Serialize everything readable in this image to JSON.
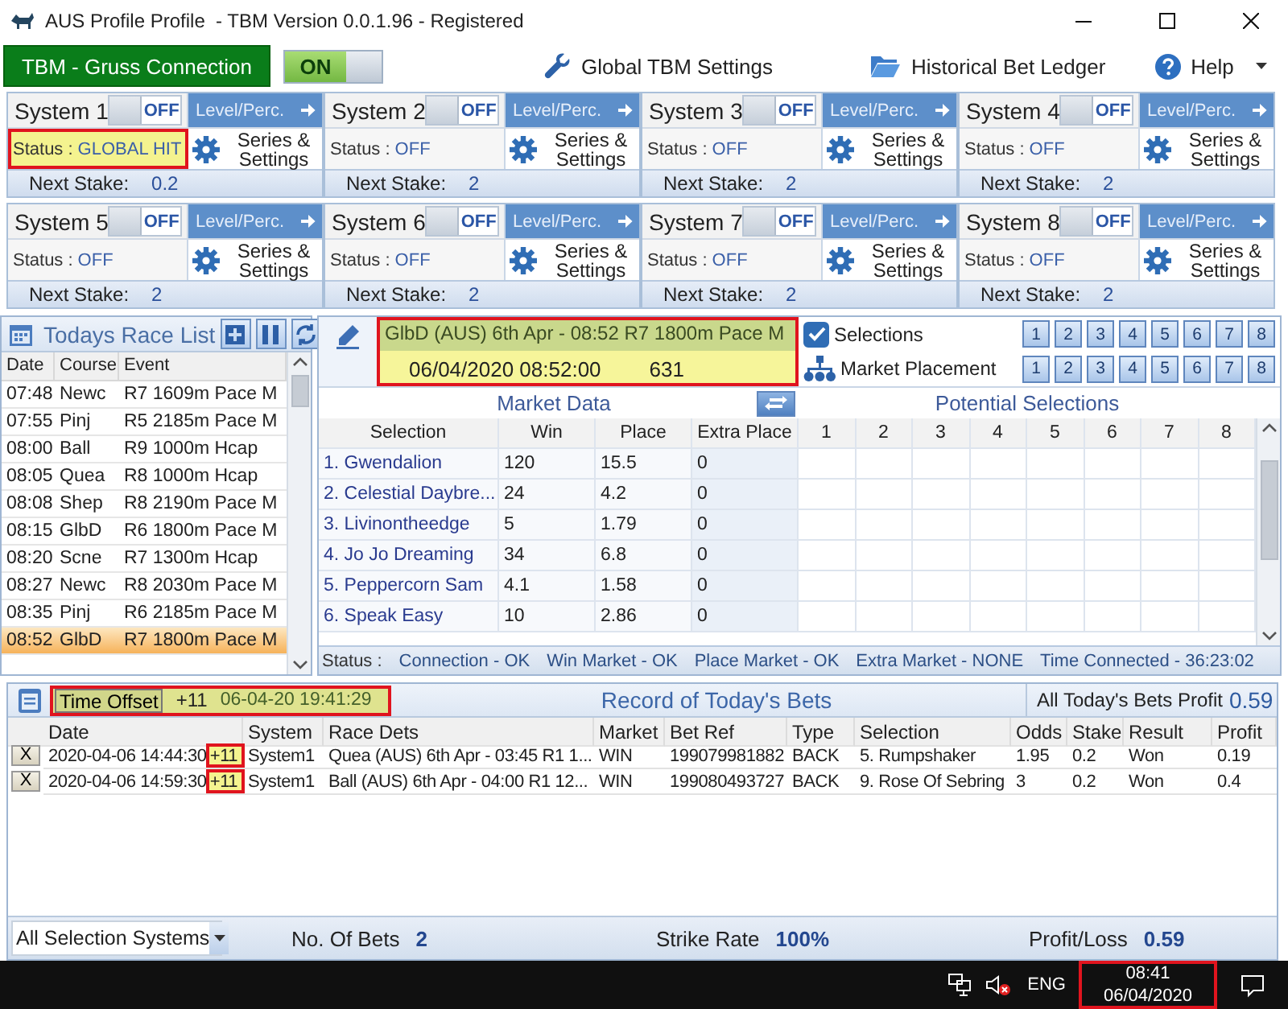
{
  "window": {
    "title": "AUS Profile Profile  - TBM Version 0.0.1.96 - Registered"
  },
  "toolbar": {
    "connection_button": "TBM - Gruss Connection",
    "connection_toggle": {
      "label": "ON",
      "on": true
    },
    "items": [
      {
        "label": "Global TBM Settings",
        "kind": "wrench"
      },
      {
        "label": "Historical Bet Ledger",
        "kind": "folder"
      },
      {
        "label": "Help",
        "kind": "help"
      }
    ]
  },
  "systems": [
    {
      "name": "System 1",
      "toggle": "OFF",
      "on": false,
      "level_button": "Level/Perc.",
      "status_label": "Status :",
      "status": "GLOBAL HIT",
      "highlighted": true,
      "settings_button": "Series & Settings",
      "stake_label": "Next Stake:",
      "stake": "0.2"
    },
    {
      "name": "System 2",
      "toggle": "OFF",
      "on": false,
      "level_button": "Level/Perc.",
      "status_label": "Status :",
      "status": "OFF",
      "highlighted": false,
      "settings_button": "Series & Settings",
      "stake_label": "Next Stake:",
      "stake": "2"
    },
    {
      "name": "System 3",
      "toggle": "OFF",
      "on": false,
      "level_button": "Level/Perc.",
      "status_label": "Status :",
      "status": "OFF",
      "highlighted": false,
      "settings_button": "Series & Settings",
      "stake_label": "Next Stake:",
      "stake": "2"
    },
    {
      "name": "System 4",
      "toggle": "OFF",
      "on": false,
      "level_button": "Level/Perc.",
      "status_label": "Status :",
      "status": "OFF",
      "highlighted": false,
      "settings_button": "Series & Settings",
      "stake_label": "Next Stake:",
      "stake": "2"
    },
    {
      "name": "System 5",
      "toggle": "OFF",
      "on": false,
      "level_button": "Level/Perc.",
      "status_label": "Status :",
      "status": "OFF",
      "highlighted": false,
      "settings_button": "Series & Settings",
      "stake_label": "Next Stake:",
      "stake": "2"
    },
    {
      "name": "System 6",
      "toggle": "OFF",
      "on": false,
      "level_button": "Level/Perc.",
      "status_label": "Status :",
      "status": "OFF",
      "highlighted": false,
      "settings_button": "Series & Settings",
      "stake_label": "Next Stake:",
      "stake": "2"
    },
    {
      "name": "System 7",
      "toggle": "OFF",
      "on": false,
      "level_button": "Level/Perc.",
      "status_label": "Status :",
      "status": "OFF",
      "highlighted": false,
      "settings_button": "Series & Settings",
      "stake_label": "Next Stake:",
      "stake": "2"
    },
    {
      "name": "System 8",
      "toggle": "OFF",
      "on": false,
      "level_button": "Level/Perc.",
      "status_label": "Status :",
      "status": "OFF",
      "highlighted": false,
      "settings_button": "Series & Settings",
      "stake_label": "Next Stake:",
      "stake": "2"
    }
  ],
  "race_list": {
    "title": "Todays Race List",
    "columns": [
      "Date",
      "Course",
      "Event"
    ],
    "rows": [
      {
        "time": "07:48",
        "course": "Newc",
        "event": "R7 1609m Pace M",
        "selected": false
      },
      {
        "time": "07:55",
        "course": "Pinj",
        "event": "R5 2185m Pace M",
        "selected": false
      },
      {
        "time": "08:00",
        "course": "Ball",
        "event": "R9 1000m Hcap",
        "selected": false
      },
      {
        "time": "08:05",
        "course": "Quea",
        "event": "R8 1000m Hcap",
        "selected": false
      },
      {
        "time": "08:08",
        "course": "Shep",
        "event": "R8 2190m Pace M",
        "selected": false
      },
      {
        "time": "08:15",
        "course": "GlbD",
        "event": "R6 1800m Pace M",
        "selected": false
      },
      {
        "time": "08:20",
        "course": "Scne",
        "event": "R7 1300m Hcap",
        "selected": false
      },
      {
        "time": "08:27",
        "course": "Newc",
        "event": "R8 2030m Pace M",
        "selected": false
      },
      {
        "time": "08:35",
        "course": "Pinj",
        "event": "R6 2185m Pace M",
        "selected": false
      },
      {
        "time": "08:52",
        "course": "GlbD",
        "event": "R7 1800m Pace M",
        "selected": true
      }
    ]
  },
  "race_header": {
    "title": "GlbD (AUS) 6th Apr - 08:52 R7 1800m Pace M",
    "start": "06/04/2020 08:52:00",
    "market_id": "631",
    "highlighted": true
  },
  "placement": [
    {
      "kind": "checkbox",
      "label": "Selections",
      "checked": true,
      "buttons": [
        "1",
        "2",
        "3",
        "4",
        "5",
        "6",
        "7",
        "8"
      ]
    },
    {
      "kind": "tree",
      "label": "Market Placement",
      "buttons": [
        "1",
        "2",
        "3",
        "4",
        "5",
        "6",
        "7",
        "8"
      ]
    }
  ],
  "market": {
    "title": "Market Data",
    "potential_title": "Potential Selections",
    "columns": [
      "Selection",
      "Win",
      "Place",
      "Extra Place",
      "1",
      "2",
      "3",
      "4",
      "5",
      "6",
      "7",
      "8"
    ],
    "rows": [
      [
        "1. Gwendalion",
        "120",
        "15.5",
        "0"
      ],
      [
        "2. Celestial Daybre...",
        "24",
        "4.2",
        "0"
      ],
      [
        "3. Livinontheedge",
        "5",
        "1.79",
        "0"
      ],
      [
        "4. Jo Jo Dreaming",
        "34",
        "6.8",
        "0"
      ],
      [
        "5. Peppercorn Sam",
        "4.1",
        "1.58",
        "0"
      ],
      [
        "6. Speak Easy",
        "10",
        "2.86",
        "0"
      ]
    ],
    "status": [
      "Status :",
      "Connection - OK",
      "Win Market - OK",
      "Place Market - OK",
      "Extra Market - NONE",
      "Time Connected - 36:23:02"
    ]
  },
  "bets": {
    "time_offset_button": "Time Offset",
    "offset": "+11",
    "clock": "06-04-20 19:41:29",
    "highlighted": true,
    "title": "Record of Today's Bets",
    "profit_label": "All Today's Bets Profit",
    "profit": "0.59",
    "columns": [
      "Date",
      "System",
      "Race Dets",
      "Market",
      "Bet Ref",
      "Type",
      "Selection",
      "Odds",
      "Stake",
      "Result",
      "Profit"
    ],
    "rows": [
      {
        "delete": "X",
        "offset": "+11",
        "offset_highlighted": true,
        "cells": [
          "2020-04-06 14:44:30",
          "System1",
          "Quea (AUS) 6th Apr - 03:45 R1 1...",
          "WIN",
          "199079981882",
          "BACK",
          "5. Rumpshaker",
          "1.95",
          "0.2",
          "Won",
          "0.19"
        ]
      },
      {
        "delete": "X",
        "offset": "+11",
        "offset_highlighted": true,
        "cells": [
          "2020-04-06 14:59:30",
          "System1",
          "Ball (AUS) 6th Apr - 04:00 R1 12...",
          "WIN",
          "199080493727",
          "BACK",
          "9. Rose Of Sebring",
          "3",
          "0.2",
          "Won",
          "0.4"
        ]
      }
    ],
    "filter": "All Selection Systems",
    "stats": [
      {
        "label": "No. Of Bets",
        "value": "2"
      },
      {
        "label": "Strike Rate",
        "value": "100%"
      },
      {
        "label": "Profit/Loss",
        "value": "0.59"
      }
    ]
  },
  "taskbar": {
    "language": "ENG",
    "time": "08:41",
    "date": "06/04/2020",
    "highlighted": true
  }
}
